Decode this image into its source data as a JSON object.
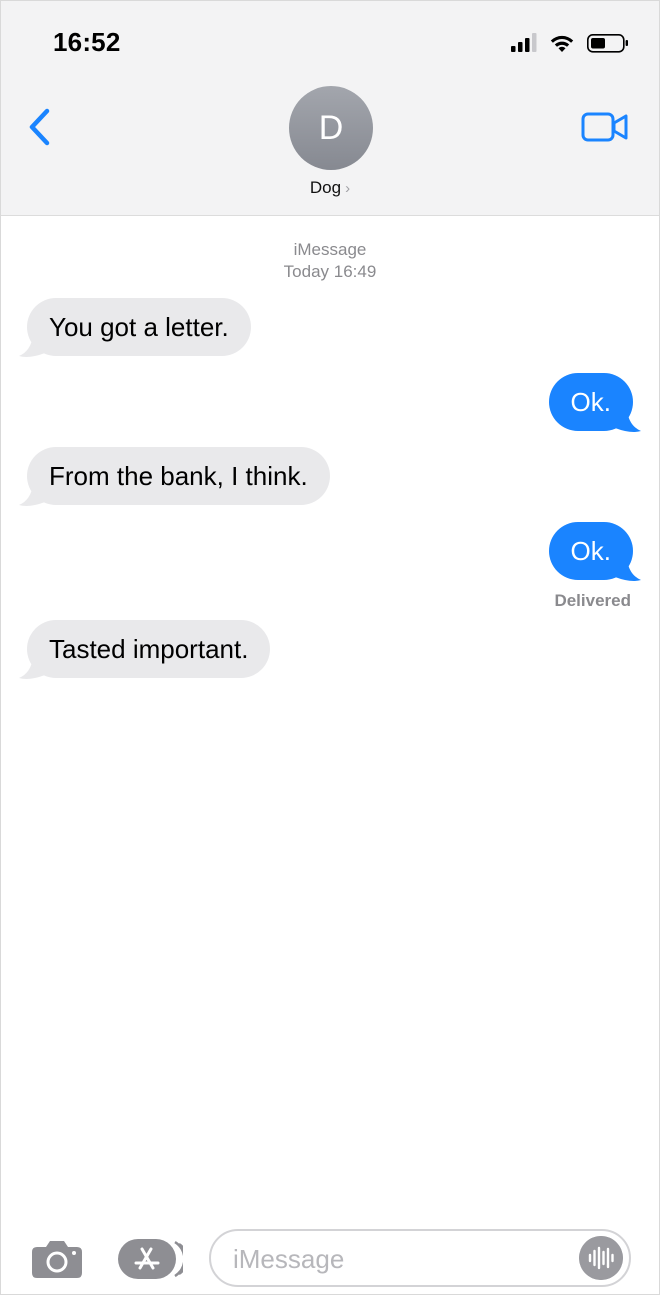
{
  "status_bar": {
    "time": "16:52"
  },
  "header": {
    "avatar_initial": "D",
    "contact_name": "Dog",
    "chevron": "›"
  },
  "thread": {
    "service": "iMessage",
    "timestamp": "Today 16:49",
    "messages": [
      {
        "direction": "incoming",
        "text": "You got a letter."
      },
      {
        "direction": "outgoing",
        "text": "Ok."
      },
      {
        "direction": "incoming",
        "text": "From the bank, I think."
      },
      {
        "direction": "outgoing",
        "text": "Ok."
      },
      {
        "direction": "incoming",
        "text": "Tasted important."
      }
    ],
    "delivered_label": "Delivered"
  },
  "composer": {
    "placeholder": "iMessage",
    "value": ""
  },
  "icons": {
    "back": "chevron-left-icon",
    "video": "video-camera-icon",
    "camera": "camera-icon",
    "apps": "app-store-icon",
    "audio": "waveform-icon"
  },
  "colors": {
    "accent": "#1a84ff",
    "incoming_bubble": "#e9e9eb",
    "header_bg": "#f3f3f4",
    "meta_text": "#8a8a8e"
  }
}
